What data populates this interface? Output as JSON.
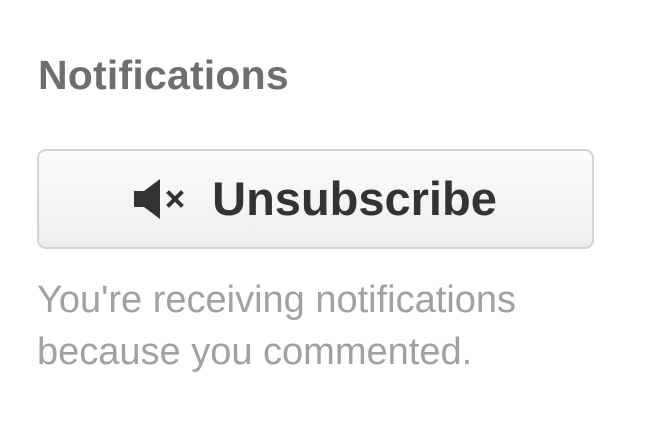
{
  "notifications": {
    "heading": "Notifications",
    "button": {
      "icon": "speaker-mute-icon",
      "label": "Unsubscribe"
    },
    "description": "You're receiving notifications because you commented."
  }
}
